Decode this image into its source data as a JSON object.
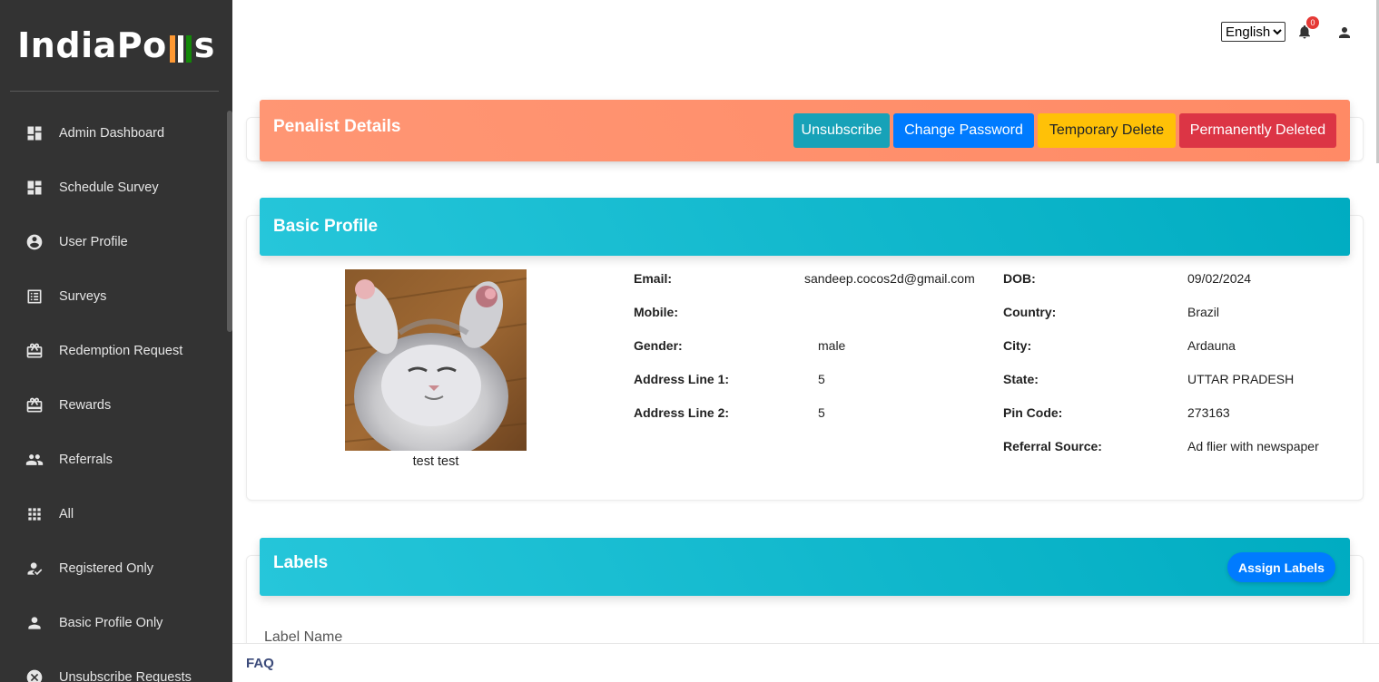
{
  "brand": {
    "logo_prefix": "IndiaPo",
    "logo_suffix": "s",
    "bar_colors": [
      "#ff9933",
      "#ffffff",
      "#138808"
    ]
  },
  "sidebar": {
    "items": [
      {
        "label": "Admin Dashboard",
        "icon": "dashboard-icon"
      },
      {
        "label": "Schedule Survey",
        "icon": "dashboard-icon"
      },
      {
        "label": "User Profile",
        "icon": "account-circle-icon"
      },
      {
        "label": "Surveys",
        "icon": "list-alt-icon"
      },
      {
        "label": "Redemption Request",
        "icon": "card-giftcard-icon"
      },
      {
        "label": "Rewards",
        "icon": "card-giftcard-icon"
      },
      {
        "label": "Referrals",
        "icon": "people-icon"
      },
      {
        "label": "All",
        "icon": "apps-icon"
      },
      {
        "label": "Registered Only",
        "icon": "how-to-reg-icon"
      },
      {
        "label": "Basic Profile Only",
        "icon": "person-icon"
      },
      {
        "label": "Unsubscribe Requests",
        "icon": "cancel-icon"
      }
    ]
  },
  "topbar": {
    "language": "English",
    "notification_count": "0"
  },
  "penalist": {
    "title": "Penalist Details",
    "buttons": {
      "unsubscribe": "Unsubscribe",
      "change_password": "Change Password",
      "temporary_delete": "Temporary Delete",
      "permanently_deleted": "Permanently Deleted"
    }
  },
  "profile": {
    "title": "Basic Profile",
    "name": "test test",
    "labels": {
      "email": "Email:",
      "mobile": "Mobile:",
      "gender": "Gender:",
      "address1": "Address Line 1:",
      "address2": "Address Line 2:",
      "dob": "DOB:",
      "country": "Country:",
      "city": "City:",
      "state": "State:",
      "pin": "Pin Code:",
      "referral": "Referral Source:"
    },
    "values": {
      "email": "sandeep.cocos2d@gmail.com",
      "mobile": "",
      "gender": "male",
      "address1": "5",
      "address2": "5",
      "dob": "09/02/2024",
      "country": "Brazil",
      "city": "Ardauna",
      "state": "UTTAR PRADESH",
      "pin": "273163",
      "referral": "Ad flier with newspaper"
    }
  },
  "labels_section": {
    "title": "Labels",
    "assign_button": "Assign Labels",
    "column_header": "Label Name"
  },
  "footer": {
    "faq": "FAQ"
  },
  "colors": {
    "sidebar_bg": "#333333",
    "orange_header": "#ff8a65",
    "cyan_header": "#00acc1",
    "primary": "#007bff"
  }
}
